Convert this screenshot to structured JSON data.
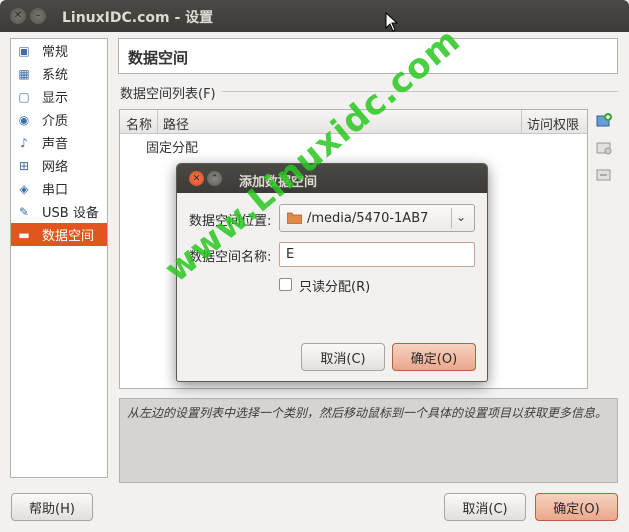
{
  "window": {
    "title": "LinuxIDC.com - 设置",
    "close_glyph": "✕",
    "min_glyph": "–"
  },
  "sidebar": {
    "items": [
      {
        "label": "常规",
        "icon": "monitor-icon",
        "glyph": "▣"
      },
      {
        "label": "系统",
        "icon": "chip-icon",
        "glyph": "▦"
      },
      {
        "label": "显示",
        "icon": "display-icon",
        "glyph": "▢"
      },
      {
        "label": "介质",
        "icon": "disc-icon",
        "glyph": "◉"
      },
      {
        "label": "声音",
        "icon": "speaker-icon",
        "glyph": "♪"
      },
      {
        "label": "网络",
        "icon": "network-icon",
        "glyph": "⊞"
      },
      {
        "label": "串口",
        "icon": "serial-port-icon",
        "glyph": "◈"
      },
      {
        "label": "USB 设备",
        "icon": "usb-icon",
        "glyph": "✎"
      },
      {
        "label": "数据空间",
        "icon": "folder-icon",
        "glyph": "▬",
        "active": true
      }
    ]
  },
  "main": {
    "header_title": "数据空间",
    "section_label": "数据空间列表(F)",
    "table": {
      "columns": [
        "名称",
        "路径",
        "访问权限"
      ],
      "group_row": "固定分配"
    },
    "info_text": "从左边的设置列表中选择一个类别，然后移动鼠标到一个具体的设置项目以获取更多信息。"
  },
  "buttons": {
    "help": "帮助(H)",
    "cancel": "取消(C)",
    "ok": "确定(O)"
  },
  "dialog": {
    "title": "添加数据空间",
    "location_label": "数据空间位置:",
    "location_value": "/media/5470-1AB7",
    "name_label": "数据空间名称:",
    "name_value": "E",
    "checkbox_label": "只读分配(R)",
    "cancel": "取消(C)",
    "ok": "确定(O)",
    "close_glyph": "✕",
    "min_glyph": "⌃"
  },
  "watermark": "www.Linuxidc.com",
  "colors": {
    "accent": "#e0561e",
    "titlebar": "#3c3b37",
    "watermark": "#28c81e"
  }
}
